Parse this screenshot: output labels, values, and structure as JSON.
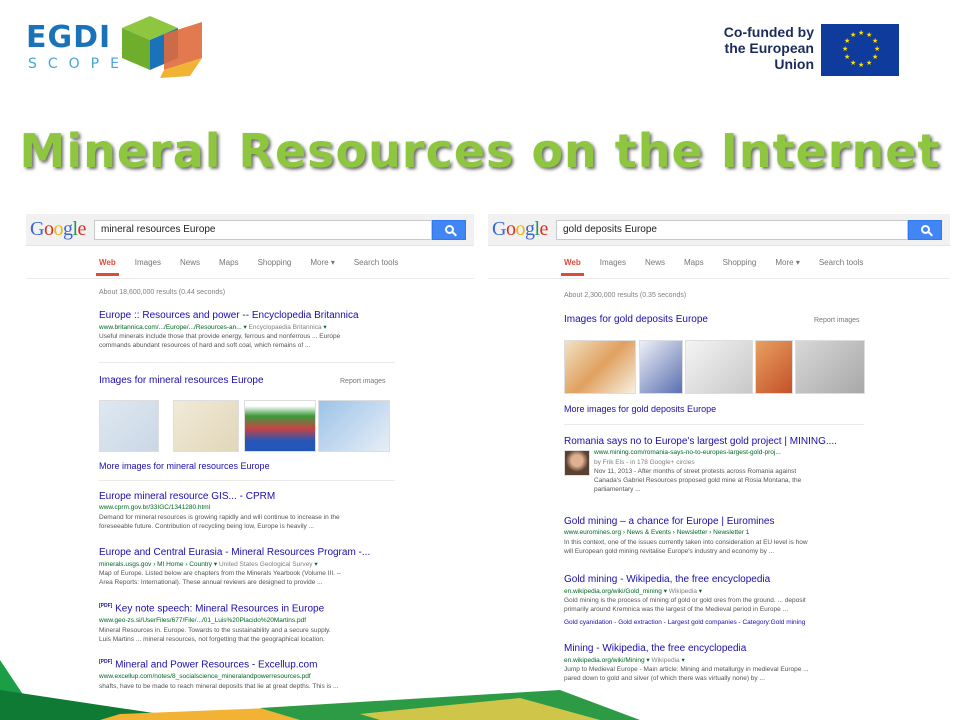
{
  "slide": {
    "title": "Mineral Resources on the Internet",
    "logo_text": "EGDI",
    "logo_sub": "SCOPE",
    "eu_line1": "Co-funded by",
    "eu_line2": "the European Union"
  },
  "left": {
    "query": "mineral resources Europe",
    "tabs": [
      "Web",
      "Images",
      "News",
      "Maps",
      "Shopping",
      "More ▾",
      "Search tools"
    ],
    "result_stats": "About 18,600,000 results (0.44 seconds)",
    "r1": {
      "title": "Europe :: Resources and power -- Encyclopedia Britannica",
      "url": "www.britannica.com/.../Europe/.../Resources-an...",
      "source": "Encyclopaedia Britannica",
      "snippet1": "Useful minerals include those that provide energy, ferrous and nonferrous ... Europe",
      "snippet2": "commands abundant resources of hard and soft coal, which remains of ..."
    },
    "images_head": "Images for mineral resources Europe",
    "report": "Report images",
    "more_images": "More images for mineral resources Europe",
    "r2": {
      "title": "Europe mineral resource GIS... - CPRM",
      "url": "www.cprm.gov.br/33IGC/1341280.html",
      "snippet1": "Demand for mineral resources is growing rapidly and will continue to increase in the",
      "snippet2": "foreseeable future. Contribution of recycling being low, Europe is heavily ..."
    },
    "r3": {
      "title": "Europe and Central Eurasia - Mineral Resources Program -...",
      "url": "minerals.usgs.gov › MI Home › Country",
      "source": "United States Geological Survey",
      "snippet1": "Map of Europe. Listed below are chapters from the Minerals Yearbook (Volume III. --",
      "snippet2": "Area Reports: International). These annual reviews are designed to provide ..."
    },
    "r4": {
      "tag": "[PDF]",
      "title": "Key note speech: Mineral Resources in Europe",
      "url": "www.geo-zs.si/UserFiles/677/File/.../01_Luis%20Placido%20Martins.pdf",
      "snippet1": "Mineral Resources in. Europe. Towards to the sustainability and a secure supply.",
      "snippet2": "Luis Martins ... mineral resources, not forgetting that the geographical location."
    },
    "r5": {
      "tag": "[PDF]",
      "title": "Mineral and Power Resources - Excellup.com",
      "url": "www.excellup.com/notes/8_socialscience_mineralandpowerresources.pdf",
      "snippet1": "shafts, have to be made to reach mineral deposits that lie at great depths. This is ..."
    }
  },
  "right": {
    "query": "gold deposits Europe",
    "tabs": [
      "Web",
      "Images",
      "News",
      "Maps",
      "Shopping",
      "More ▾",
      "Search tools"
    ],
    "result_stats": "About 2,300,000 results (0.35 seconds)",
    "images_head": "Images for gold deposits Europe",
    "report": "Report images",
    "more_images": "More images for gold deposits Europe",
    "r1": {
      "title": "Romania says no to Europe's largest gold project | MINING....",
      "url": "www.mining.com/romania-says-no-to-europes-largest-gold-proj...",
      "byline": "by Frik Els - in 178 Google+ circles",
      "snippet1": "Nov 11, 2013 - After months of street protests across Romania against",
      "snippet2": "Canada's Gabriel Resources proposed gold mine at Rosia Montana, the",
      "snippet3": "parliamentary ..."
    },
    "r2": {
      "title": "Gold mining – a chance for Europe | Euromines",
      "url": "www.euromines.org › News & Events › Newsletter › Newsletter 1",
      "snippet1": "In this context, one of the issues currently taken into consideration at EU level is how",
      "snippet2": "will European gold mining revitalise Europe's industry and economy by ..."
    },
    "r3": {
      "title": "Gold mining - Wikipedia, the free encyclopedia",
      "url": "en.wikipedia.org/wiki/Gold_mining",
      "source": "Wikipedia",
      "snippet1": "Gold mining is the process of mining of gold or gold ores from the ground. ... deposit",
      "snippet2": "primarily around Kremnica was the largest of the Medieval period in Europe ...",
      "sitelinks": "Gold cyanidation - Gold extraction - Largest gold companies - Category:Gold mining"
    },
    "r4": {
      "title": "Mining - Wikipedia, the free encyclopedia",
      "url": "en.wikipedia.org/wiki/Mining",
      "source": "Wikipedia",
      "snippet1": "Jump to Medieval Europe - Main article: Mining and metallurgy in medieval Europe ...",
      "snippet2": "pared down to gold and silver (of which there was virtually none) by ..."
    }
  },
  "colors": {
    "title_green": "#8ec63f",
    "link_blue": "#1a0dab",
    "url_green": "#006621",
    "active_tab": "#dd4b39",
    "search_blue": "#4285f4",
    "eu_blue": "#0f3b9c",
    "eu_star": "#ffdd00"
  }
}
